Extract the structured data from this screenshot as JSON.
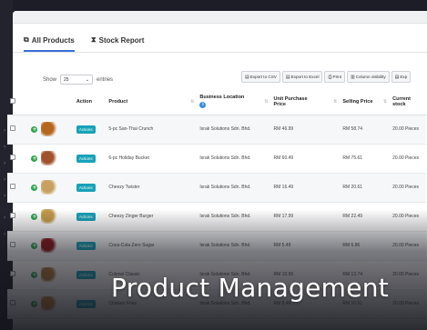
{
  "tabs": [
    {
      "label": "All Products",
      "icon": "cubes-icon",
      "active": true
    },
    {
      "label": "Stock Report",
      "icon": "hourglass-icon",
      "active": false
    }
  ],
  "length_control": {
    "prefix": "Show",
    "value": "25",
    "suffix": "entries"
  },
  "export_buttons": [
    {
      "label": "Export to CSV",
      "icon": "file-csv-icon"
    },
    {
      "label": "Export to Excel",
      "icon": "file-excel-icon"
    },
    {
      "label": "Print",
      "icon": "print-icon"
    },
    {
      "label": "Column visibility",
      "icon": "columns-icon"
    },
    {
      "label": "Exp",
      "icon": "file-pdf-icon"
    }
  ],
  "table": {
    "headers": {
      "action": "Action",
      "product": "Product",
      "business_location": "Business Location",
      "unit_purchase_price": "Unit Purchase Price",
      "selling_price": "Selling Price",
      "current_stock": "Current stock"
    },
    "action_label": "Actions",
    "rows": [
      {
        "product": "5-pc San-Thai Crunch",
        "location": "Israk Solutions Sdn. Bhd.",
        "purchase": "RM 46.99",
        "selling": "RM 58.74",
        "stock": "20.00 Pieces",
        "thumb_color": "#b5651d"
      },
      {
        "product": "6-pc Holiday Bucket",
        "location": "Israk Solutions Sdn. Bhd.",
        "purchase": "RM 60.49",
        "selling": "RM 75.61",
        "stock": "20.00 Pieces",
        "thumb_color": "#a0522d"
      },
      {
        "product": "Cheezy Twister",
        "location": "Israk Solutions Sdn. Bhd.",
        "purchase": "RM 16.49",
        "selling": "RM 20.61",
        "stock": "20.00 Pieces",
        "thumb_color": "#c8a060"
      },
      {
        "product": "Cheezy Zinger Burger",
        "location": "Israk Solutions Sdn. Bhd.",
        "purchase": "RM 17.99",
        "selling": "RM 22.49",
        "stock": "20.00 Pieces",
        "thumb_color": "#c49a4a"
      },
      {
        "product": "Coca-Cola Zero Sugar",
        "location": "Israk Solutions Sdn. Bhd.",
        "purchase": "RM 5.49",
        "selling": "RM 6.86",
        "stock": "20.00 Pieces",
        "thumb_color": "#8b1a1a"
      },
      {
        "product": "Colonel Classic",
        "location": "Israk Solutions Sdn. Bhd.",
        "purchase": "RM 10.99",
        "selling": "RM 13.74",
        "stock": "20.00 Pieces",
        "thumb_color": "#b07a3a"
      },
      {
        "product": "Chicken Fries",
        "location": "Israk Solutions Sdn. Bhd.",
        "purchase": "RM 8.49",
        "selling": "RM 10.61",
        "stock": "20.00 Pieces",
        "thumb_color": "#c9843a"
      }
    ]
  },
  "headline": "Product Management"
}
